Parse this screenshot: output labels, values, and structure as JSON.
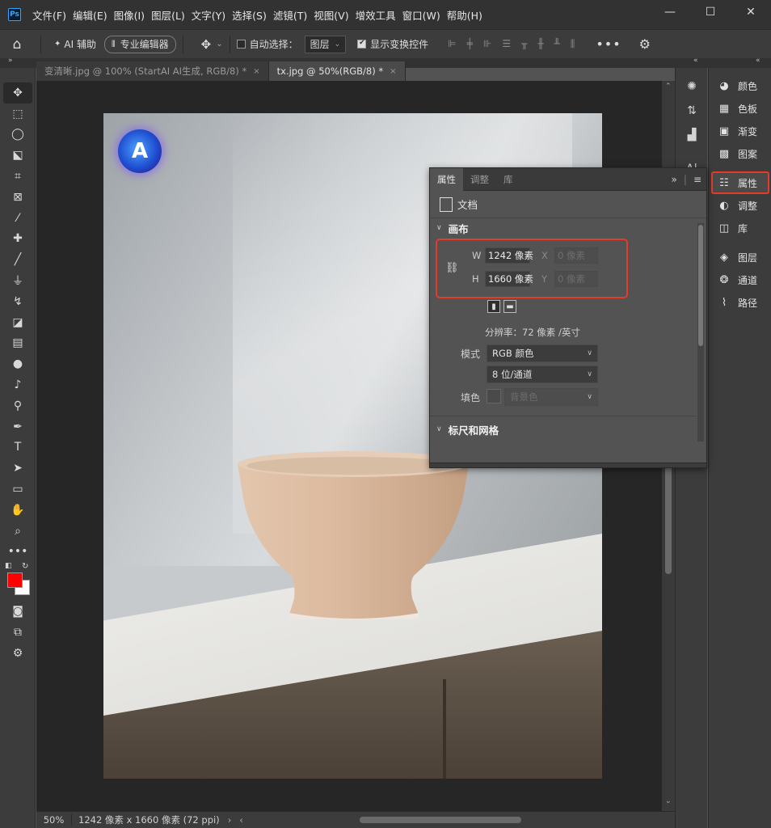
{
  "menubar": {
    "logo": "Ps",
    "items": [
      "文件(F)",
      "编辑(E)",
      "图像(I)",
      "图层(L)",
      "文字(Y)",
      "选择(S)",
      "滤镜(T)",
      "视图(V)",
      "增效工具",
      "窗口(W)",
      "帮助(H)"
    ],
    "window_controls": {
      "minimize": "—",
      "maximize": "☐",
      "close": "✕"
    }
  },
  "optionsbar": {
    "ai_assist_label": "AI 辅助",
    "pro_editor_label": "专业编辑器",
    "auto_select_label": "自动选择：",
    "auto_select_value": "图层",
    "show_transform_label": "显示变换控件",
    "more_label": "•••"
  },
  "tabs": [
    {
      "title": "变清晰.jpg @ 100% (StartAI AI生成, RGB/8) *",
      "close": "×"
    },
    {
      "title": "tx.jpg @ 50%(RGB/8) *",
      "close": "×"
    }
  ],
  "statusbar": {
    "zoom": "50%",
    "doc_info": "1242 像素 x 1660 像素 (72 ppi)",
    "arrow": "›",
    "left_arrow": "‹"
  },
  "canvas": {
    "badge_letter": "A"
  },
  "dock": {
    "group1": [
      {
        "label": "颜色",
        "icon": "palette-icon"
      },
      {
        "label": "色板",
        "icon": "swatches-icon"
      },
      {
        "label": "渐变",
        "icon": "gradient-icon"
      },
      {
        "label": "图案",
        "icon": "pattern-icon"
      }
    ],
    "group2": [
      {
        "label": "属性",
        "icon": "properties-icon"
      },
      {
        "label": "调整",
        "icon": "adjustments-icon"
      },
      {
        "label": "库",
        "icon": "libraries-icon"
      }
    ],
    "group3": [
      {
        "label": "图层",
        "icon": "layers-icon"
      },
      {
        "label": "通道",
        "icon": "channels-icon"
      },
      {
        "label": "路径",
        "icon": "paths-icon"
      }
    ]
  },
  "properties": {
    "tabs": [
      "属性",
      "调整",
      "库"
    ],
    "doc_label": "文档",
    "canvas_section": "画布",
    "w_label": "W",
    "w_value": "1242 像素",
    "h_label": "H",
    "h_value": "1660 像素",
    "x_label": "X",
    "x_placeholder": "0 像素",
    "y_label": "Y",
    "y_placeholder": "0 像素",
    "resolution": "分辨率：72 像素 /英寸",
    "mode_label": "模式",
    "mode_value": "RGB 颜色",
    "depth_value": "8 位/通道",
    "fill_label": "填色",
    "fill_value": "背景色",
    "rulers_section": "标尺和网格"
  },
  "colors": {
    "accent_red": "#e53b2a",
    "foreground": "#ff0000",
    "background": "#ffffff"
  }
}
